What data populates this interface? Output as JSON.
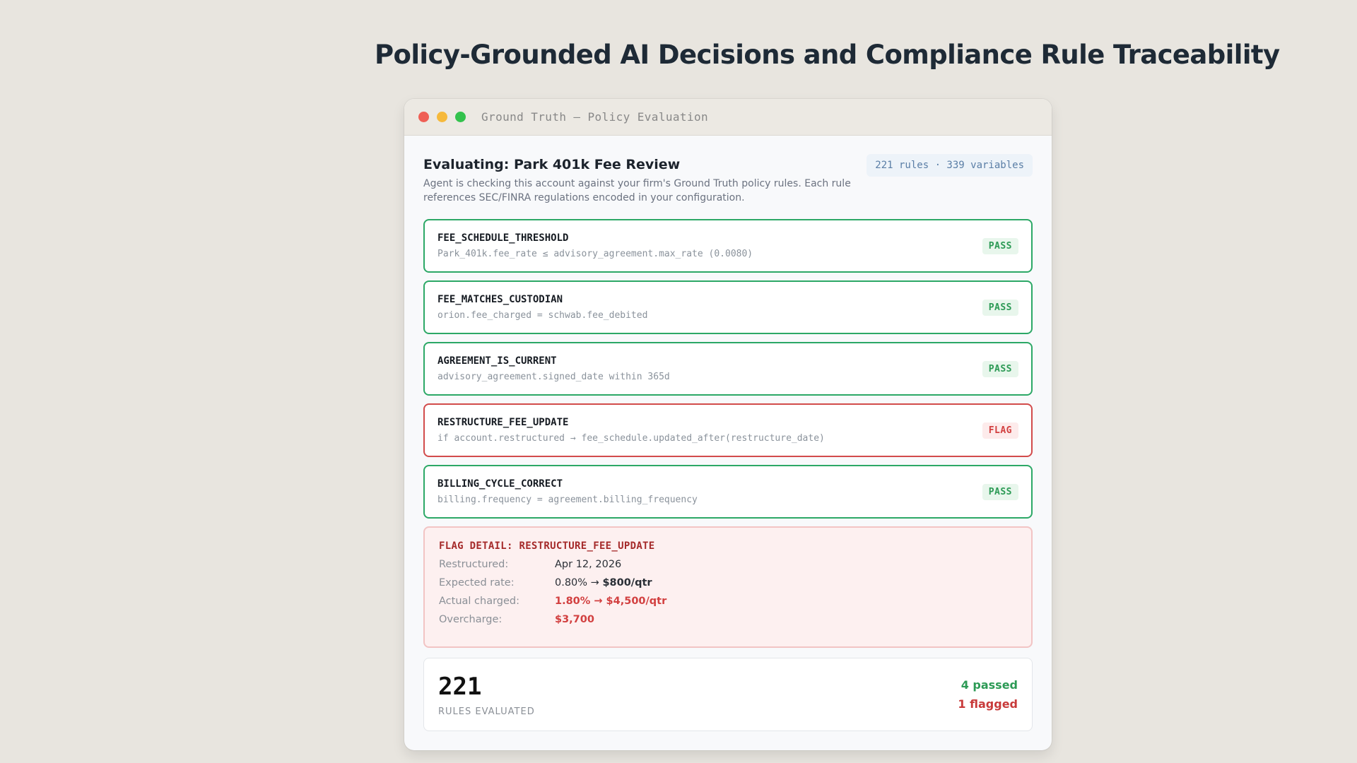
{
  "page": {
    "title": "Policy-Grounded AI Decisions and Compliance Rule Traceability"
  },
  "window": {
    "title": "Ground Truth — Policy Evaluation",
    "controls": [
      "close",
      "minimize",
      "maximize"
    ]
  },
  "evaluation": {
    "title": "Evaluating: Park 401k Fee Review",
    "stats": "221 rules · 339 variables",
    "description": "Agent is checking this account against your firm's Ground Truth policy rules. Each rule references SEC/FINRA regulations encoded in your configuration."
  },
  "rules": [
    {
      "name": "FEE_SCHEDULE_THRESHOLD",
      "expression": "Park_401k.fee_rate ≤ advisory_agreement.max_rate (0.0080)",
      "status": "PASS"
    },
    {
      "name": "FEE_MATCHES_CUSTODIAN",
      "expression": "orion.fee_charged = schwab.fee_debited",
      "status": "PASS"
    },
    {
      "name": "AGREEMENT_IS_CURRENT",
      "expression": "advisory_agreement.signed_date within 365d",
      "status": "PASS"
    },
    {
      "name": "RESTRUCTURE_FEE_UPDATE",
      "expression": "if account.restructured → fee_schedule.updated_after(restructure_date)",
      "status": "FLAG"
    },
    {
      "name": "BILLING_CYCLE_CORRECT",
      "expression": "billing.frequency = agreement.billing_frequency",
      "status": "PASS"
    }
  ],
  "flag_detail": {
    "title": "FLAG DETAIL: RESTRUCTURE_FEE_UPDATE",
    "restructured_label": "Restructured:",
    "restructured_value": "Apr 12, 2026",
    "expected_label": "Expected rate:",
    "expected_rate": "0.80% →",
    "expected_amount": "$800/qtr",
    "actual_label": "Actual charged:",
    "actual_value": "1.80% → $4,500/qtr",
    "overcharge_label": "Overcharge:",
    "overcharge_value": "$3,700"
  },
  "summary": {
    "count": "221",
    "label": "RULES EVALUATED",
    "passed": "4 passed",
    "flagged": "1 flagged"
  },
  "colors": {
    "pass": "#2c9a55",
    "flag": "#d24040",
    "background": "#e8e5df"
  }
}
